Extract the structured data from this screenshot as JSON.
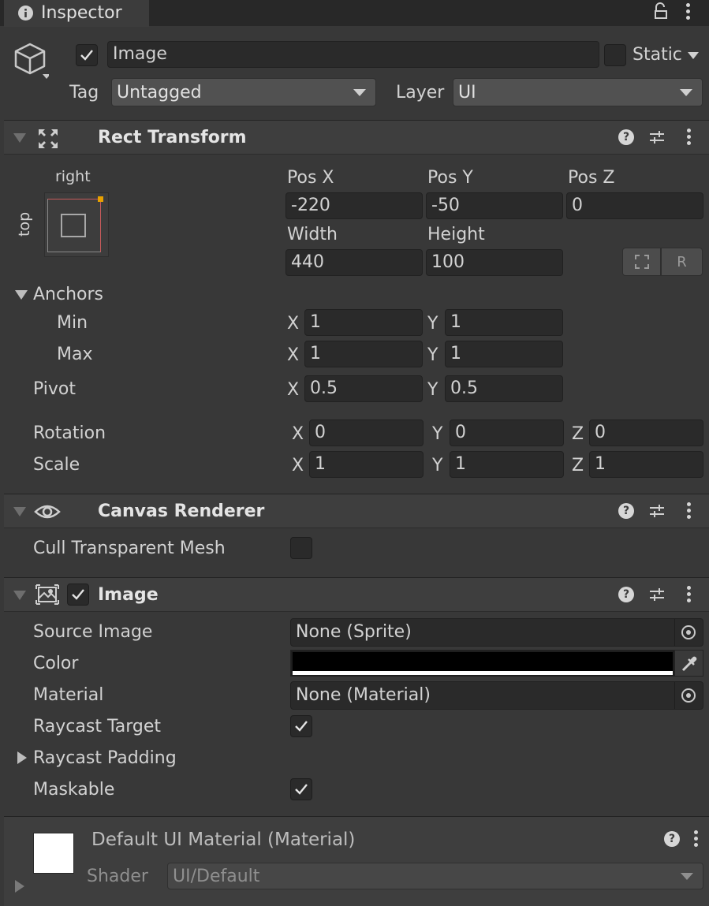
{
  "tab": {
    "label": "Inspector"
  },
  "object": {
    "name": "Image",
    "active": true,
    "static_label": "Static",
    "tag_label": "Tag",
    "tag_value": "Untagged",
    "layer_label": "Layer",
    "layer_value": "UI"
  },
  "rect_transform": {
    "title": "Rect Transform",
    "anchor_preset": {
      "h": "right",
      "v": "top"
    },
    "pos_x_label": "Pos X",
    "pos_x": "-220",
    "pos_y_label": "Pos Y",
    "pos_y": "-50",
    "pos_z_label": "Pos Z",
    "pos_z": "0",
    "width_label": "Width",
    "width": "440",
    "height_label": "Height",
    "height": "100",
    "raw_button": "R",
    "anchors_label": "Anchors",
    "min_label": "Min",
    "min_x": "1",
    "min_y": "1",
    "max_label": "Max",
    "max_x": "1",
    "max_y": "1",
    "pivot_label": "Pivot",
    "pivot_x": "0.5",
    "pivot_y": "0.5",
    "rotation_label": "Rotation",
    "rot_x": "0",
    "rot_y": "0",
    "rot_z": "0",
    "scale_label": "Scale",
    "scale_x": "1",
    "scale_y": "1",
    "scale_z": "1",
    "x": "X",
    "y": "Y",
    "z": "Z"
  },
  "canvas_renderer": {
    "title": "Canvas Renderer",
    "cull_label": "Cull Transparent Mesh",
    "cull_checked": false
  },
  "image": {
    "title": "Image",
    "enabled": true,
    "source_label": "Source Image",
    "source_value": "None (Sprite)",
    "color_label": "Color",
    "color_value": "#000000",
    "material_label": "Material",
    "material_value": "None (Material)",
    "raycast_target_label": "Raycast Target",
    "raycast_target_checked": true,
    "raycast_padding_label": "Raycast Padding",
    "maskable_label": "Maskable",
    "maskable_checked": true
  },
  "material_preview": {
    "title": "Default UI Material (Material)",
    "shader_label": "Shader",
    "shader_value": "UI/Default"
  },
  "colors": {
    "background": "#383838",
    "field": "#2a2a2a",
    "header": "#3e3e3e",
    "accent": "#e8a100"
  }
}
